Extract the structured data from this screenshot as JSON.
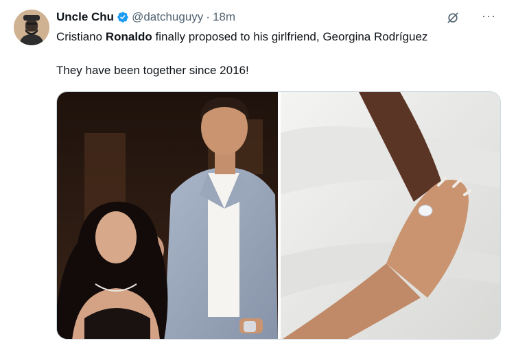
{
  "tweet": {
    "author_name": "Uncle Chu",
    "handle": "@datchuguyy",
    "separator": "·",
    "time": "18m",
    "text_line1_part1": "Cristiano ",
    "text_line1_bold": "Ronaldo",
    "text_line1_part2": " finally proposed to his girlfriend, Georgina Rodríguez",
    "text_line2": "They have been together since 2016!",
    "more_label": "···"
  },
  "icons": {
    "verified": "verified-badge-icon",
    "grok": "grok-icon",
    "more": "more-icon"
  },
  "colors": {
    "verified": "#1d9bf0",
    "text": "#0f1419",
    "secondary": "#536471"
  }
}
